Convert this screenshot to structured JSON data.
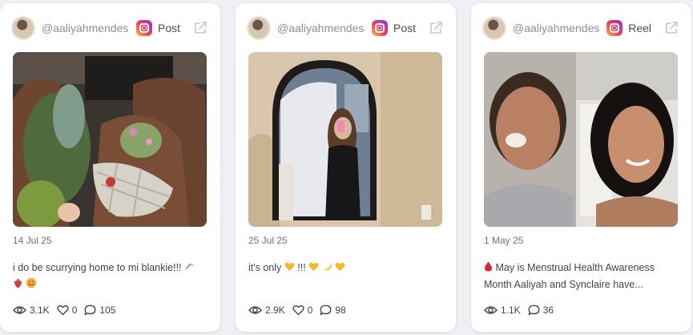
{
  "cards": [
    {
      "username": "@aaliyahmendes",
      "platform_icon": "instagram-icon",
      "post_type": "Post",
      "date": "14 Jul 25",
      "caption": "i do be scurrying home to mi blankie!!!",
      "caption_emojis": [
        "shell-emoji",
        "strawberry-emoji",
        "smiling-face-emoji"
      ],
      "views": "3.1K",
      "likes": "0",
      "comments": "105"
    },
    {
      "username": "@aaliyahmendes",
      "platform_icon": "instagram-icon",
      "post_type": "Post",
      "date": "25 Jul 25",
      "caption": "it's only",
      "caption_tail": "!!!",
      "caption_emojis": [
        "yellow-heart-emoji",
        "yellow-heart-emoji",
        "crescent-moon-emoji",
        "yellow-heart-emoji"
      ],
      "views": "2.9K",
      "likes": "0",
      "comments": "98"
    },
    {
      "username": "@aaliyahmendes",
      "platform_icon": "instagram-icon",
      "post_type": "Reel",
      "date": "1 May 25",
      "caption": "May is Menstrual Health Awareness Month Aaliyah and Synclaire have...",
      "caption_emojis": [
        "drop-of-blood-emoji"
      ],
      "views": "1.1K",
      "comments": "36"
    }
  ],
  "colors": {
    "background": "#eef0f4",
    "card": "#ffffff",
    "muted_text": "#8a8f9c",
    "body_text": "#3f4452"
  }
}
